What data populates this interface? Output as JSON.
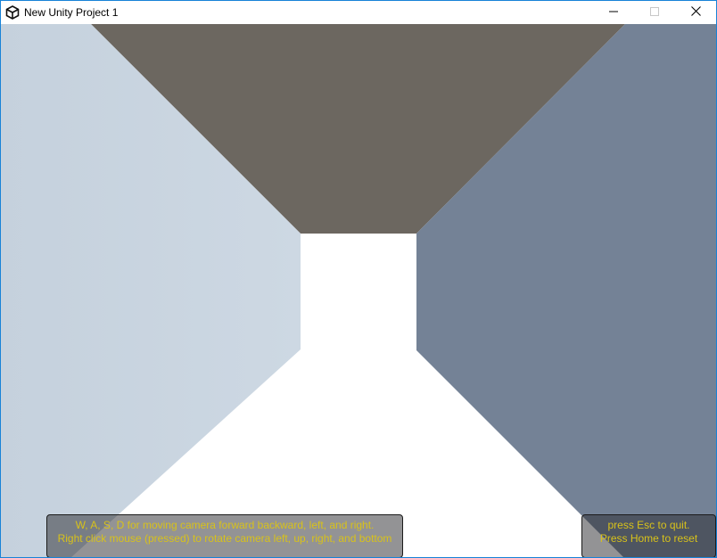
{
  "window": {
    "title": "New Unity Project 1",
    "icons": {
      "app": "unity-logo-icon",
      "minimize": "minimize-icon",
      "maximize": "maximize-icon",
      "close": "close-icon"
    }
  },
  "scene": {
    "colors": {
      "ceiling": "#6c6760",
      "left_wall": "#c9d5e0",
      "right_wall": "#748296",
      "floor": "#ffffff",
      "back_wall": "#ffffff"
    }
  },
  "hud": {
    "controls_help": {
      "line1": "W, A, S, D for moving camera forward backward, left, and right.",
      "line2": "Right click mouse (pressed) to rotate camera left, up, right, and bottom"
    },
    "system_help": {
      "line1": "press Esc to quit.",
      "line2": "Press Home to reset"
    },
    "text_color": "#d8c21a"
  }
}
